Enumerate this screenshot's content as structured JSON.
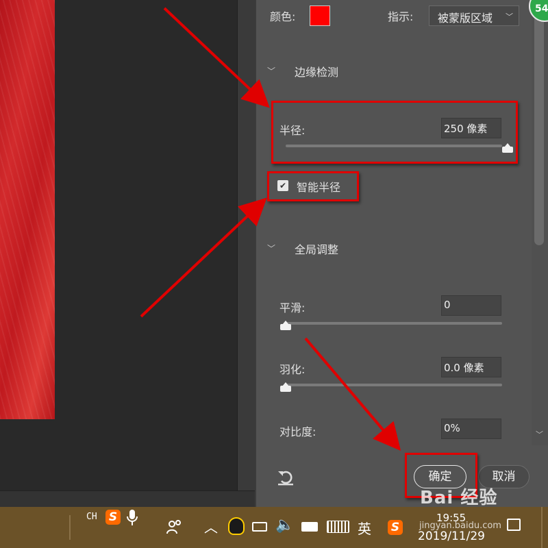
{
  "panel": {
    "color_label": "颜色:",
    "color_value": "#ff0000",
    "view_label": "指示:",
    "view_value": "被蒙版区域",
    "edge_detection": {
      "title": "边缘检测",
      "radius_label": "半径:",
      "radius_value": "250 像素",
      "radius_level": 1.0,
      "smart_radius_label": "智能半径",
      "smart_radius_checked": true
    },
    "global_refine": {
      "title": "全局调整",
      "smooth_label": "平滑:",
      "smooth_value": "0",
      "smooth_level": 0,
      "feather_label": "羽化:",
      "feather_value": "0.0 像素",
      "feather_level": 0,
      "contrast_label": "对比度:",
      "contrast_value": "0%"
    },
    "ok_label": "确定",
    "cancel_label": "取消"
  },
  "badge": "54",
  "taskbar": {
    "lang": "CH",
    "ime_mode": "英",
    "sogou_label": "S",
    "time": "19:55",
    "date": "2019/11/29"
  },
  "watermark": {
    "brand": "Bai 经验",
    "url": "jingyan.baidu.com"
  },
  "colors": {
    "annotation_red": "#e00000",
    "panel_bg": "#535353",
    "taskbar_bg": "#6b5228"
  }
}
